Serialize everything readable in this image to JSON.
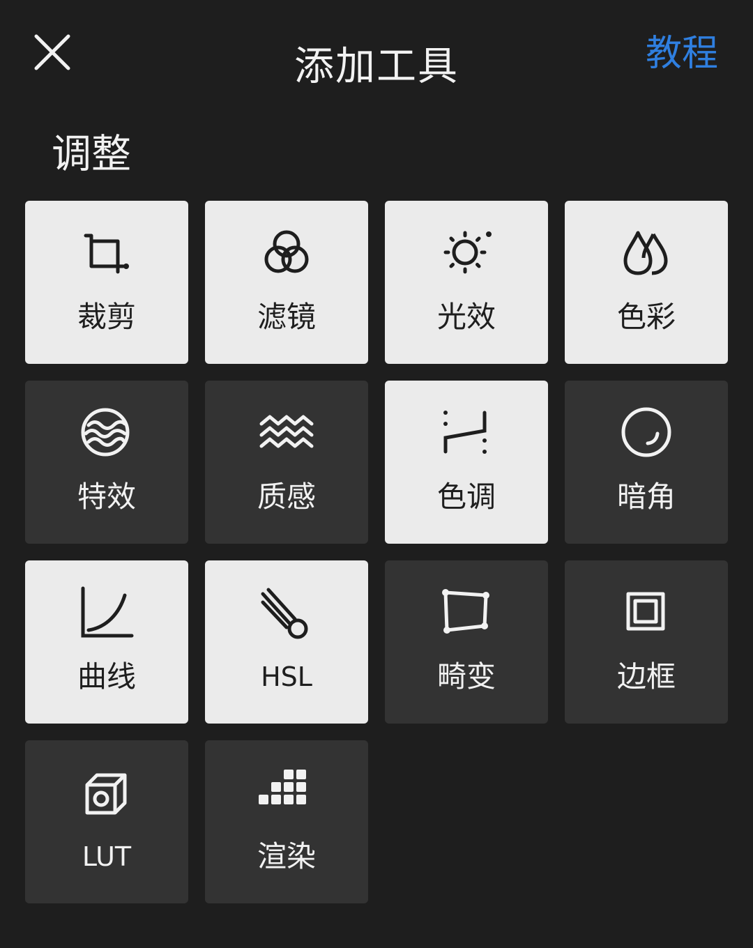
{
  "header": {
    "close_icon": "close-icon",
    "title": "添加工具",
    "tutorial_label": "教程",
    "accent_color": "#2f7fe0"
  },
  "section": {
    "title": "调整"
  },
  "tools": [
    {
      "label": "裁剪",
      "icon": "crop-icon",
      "selected": true
    },
    {
      "label": "滤镜",
      "icon": "filter-circles-icon",
      "selected": true
    },
    {
      "label": "光效",
      "icon": "sun-icon",
      "selected": true
    },
    {
      "label": "色彩",
      "icon": "droplets-icon",
      "selected": true
    },
    {
      "label": "特效",
      "icon": "waves-circle-icon",
      "selected": false
    },
    {
      "label": "质感",
      "icon": "texture-waves-icon",
      "selected": false
    },
    {
      "label": "色调",
      "icon": "tone-icon",
      "selected": true
    },
    {
      "label": "暗角",
      "icon": "vignette-icon",
      "selected": false
    },
    {
      "label": "曲线",
      "icon": "curve-icon",
      "selected": true
    },
    {
      "label": "HSL",
      "icon": "hsl-icon",
      "selected": true
    },
    {
      "label": "畸变",
      "icon": "distortion-icon",
      "selected": false
    },
    {
      "label": "边框",
      "icon": "frame-icon",
      "selected": false
    },
    {
      "label": "LUT",
      "icon": "lut-cube-icon",
      "selected": false
    },
    {
      "label": "渲染",
      "icon": "render-grid-icon",
      "selected": false
    }
  ],
  "colors": {
    "background": "#1e1e1e",
    "tile_selected": "#ebebeb",
    "tile_unselected": "#333333"
  }
}
